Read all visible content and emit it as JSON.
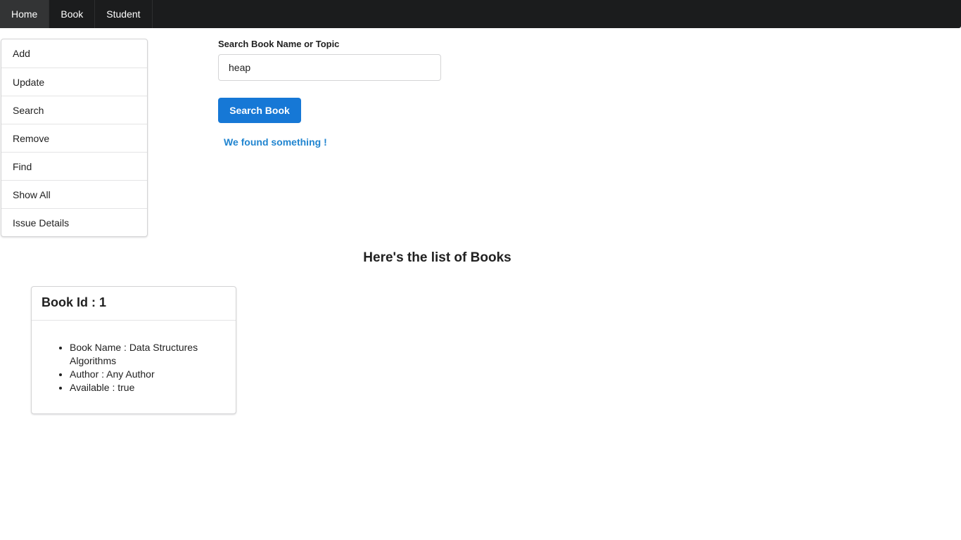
{
  "topbar": {
    "items": [
      {
        "label": "Home",
        "active": true
      },
      {
        "label": "Book",
        "active": false
      },
      {
        "label": "Student",
        "active": false
      }
    ]
  },
  "sidebar": {
    "items": [
      {
        "label": "Add"
      },
      {
        "label": "Update"
      },
      {
        "label": "Search"
      },
      {
        "label": "Remove"
      },
      {
        "label": "Find"
      },
      {
        "label": "Show All"
      },
      {
        "label": "Issue Details"
      }
    ]
  },
  "search": {
    "label": "Search Book Name or Topic",
    "value": "heap",
    "button_label": "Search Book",
    "result_message": "We found something !"
  },
  "results": {
    "heading": "Here's the list of Books",
    "books": [
      {
        "title": "Book Id : 1",
        "details": [
          "Book Name : Data Structures Algorithms",
          "Author : Any Author",
          "Available : true"
        ]
      }
    ]
  },
  "colors": {
    "topbar_bg": "#1b1c1d",
    "primary_button": "#1678d6",
    "message_text": "#2185d0"
  }
}
